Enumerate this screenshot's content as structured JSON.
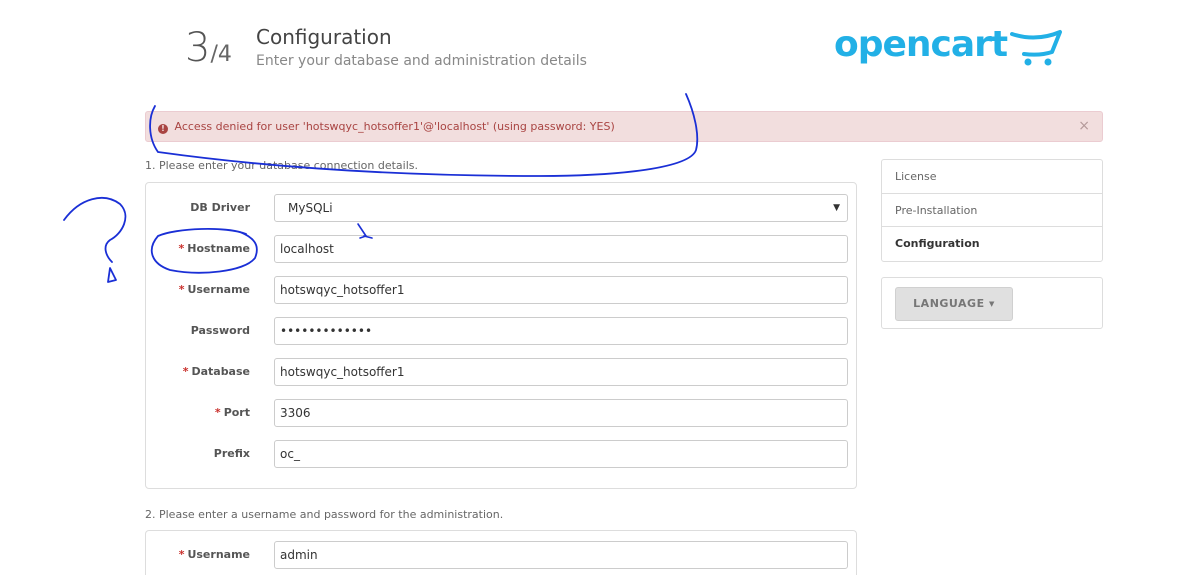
{
  "header": {
    "step_number": "3",
    "step_total": "/4",
    "title": "Configuration",
    "subtitle": "Enter your database and administration details",
    "logo_text": "opencart"
  },
  "alert": {
    "message": "Access denied for user 'hotswqyc_hotsoffer1'@'localhost' (using password: YES)",
    "close_glyph": "×",
    "icon_glyph": "!"
  },
  "section1": {
    "label": "1. Please enter your database connection details.",
    "fields": {
      "db_driver": {
        "label": "DB Driver",
        "value": "MySQLi",
        "required": false
      },
      "hostname": {
        "label": "Hostname",
        "value": "localhost",
        "required": true
      },
      "username": {
        "label": "Username",
        "value": "hotswqyc_hotsoffer1",
        "required": true
      },
      "password": {
        "label": "Password",
        "value": "•••••••••••••",
        "required": false
      },
      "database": {
        "label": "Database",
        "value": "hotswqyc_hotsoffer1",
        "required": true
      },
      "port": {
        "label": "Port",
        "value": "3306",
        "required": true
      },
      "prefix": {
        "label": "Prefix",
        "value": "oc_",
        "required": false
      }
    }
  },
  "section2": {
    "label": "2. Please enter a username and password for the administration.",
    "fields": {
      "admin_username": {
        "label": "Username",
        "value": "admin",
        "required": true
      }
    }
  },
  "sidebar": {
    "items": [
      {
        "label": "License",
        "active": false
      },
      {
        "label": "Pre-Installation",
        "active": false
      },
      {
        "label": "Configuration",
        "active": true
      }
    ]
  },
  "language": {
    "button_label": "LANGUAGE",
    "caret": "▼"
  },
  "required_marker": "*",
  "select_caret": "▼",
  "colors": {
    "logo_blue": "#22b0e6",
    "alert_bg": "#f2dede",
    "alert_text": "#a94442",
    "required_red": "#c9302c",
    "annotation_blue": "#1a2fd6"
  },
  "icons": {
    "alert": "exclamation-circle-icon",
    "close": "close-icon",
    "cart": "cart-icon"
  }
}
